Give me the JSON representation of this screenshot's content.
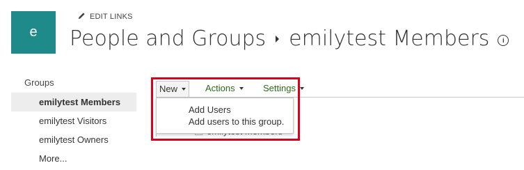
{
  "site": {
    "logo_letter": "e",
    "edit_links": "EDIT LINKS"
  },
  "header": {
    "breadcrumb_root": "People and Groups",
    "breadcrumb_current": "emilytest Members",
    "info_glyph": "i"
  },
  "sidebar": {
    "heading": "Groups",
    "items": [
      {
        "label": "emilytest Members",
        "selected": true
      },
      {
        "label": "emilytest Visitors",
        "selected": false
      },
      {
        "label": "emilytest Owners",
        "selected": false
      },
      {
        "label": "More...",
        "selected": false
      }
    ]
  },
  "toolbar": {
    "new_label": "New",
    "actions_label": "Actions",
    "settings_label": "Settings"
  },
  "new_menu": {
    "item_title": "Add Users",
    "item_description": "Add users to this group."
  },
  "list": {
    "partially_hidden_row": "emilytest Members"
  },
  "colors": {
    "logo_tile": "#1f8a8a",
    "highlight": "#d9001b",
    "link_green": "#2a6b16",
    "selected_bg": "#ededed"
  },
  "icons": {
    "edit": "pencil-icon",
    "info": "info-icon",
    "separator": "chevron-right-icon"
  }
}
